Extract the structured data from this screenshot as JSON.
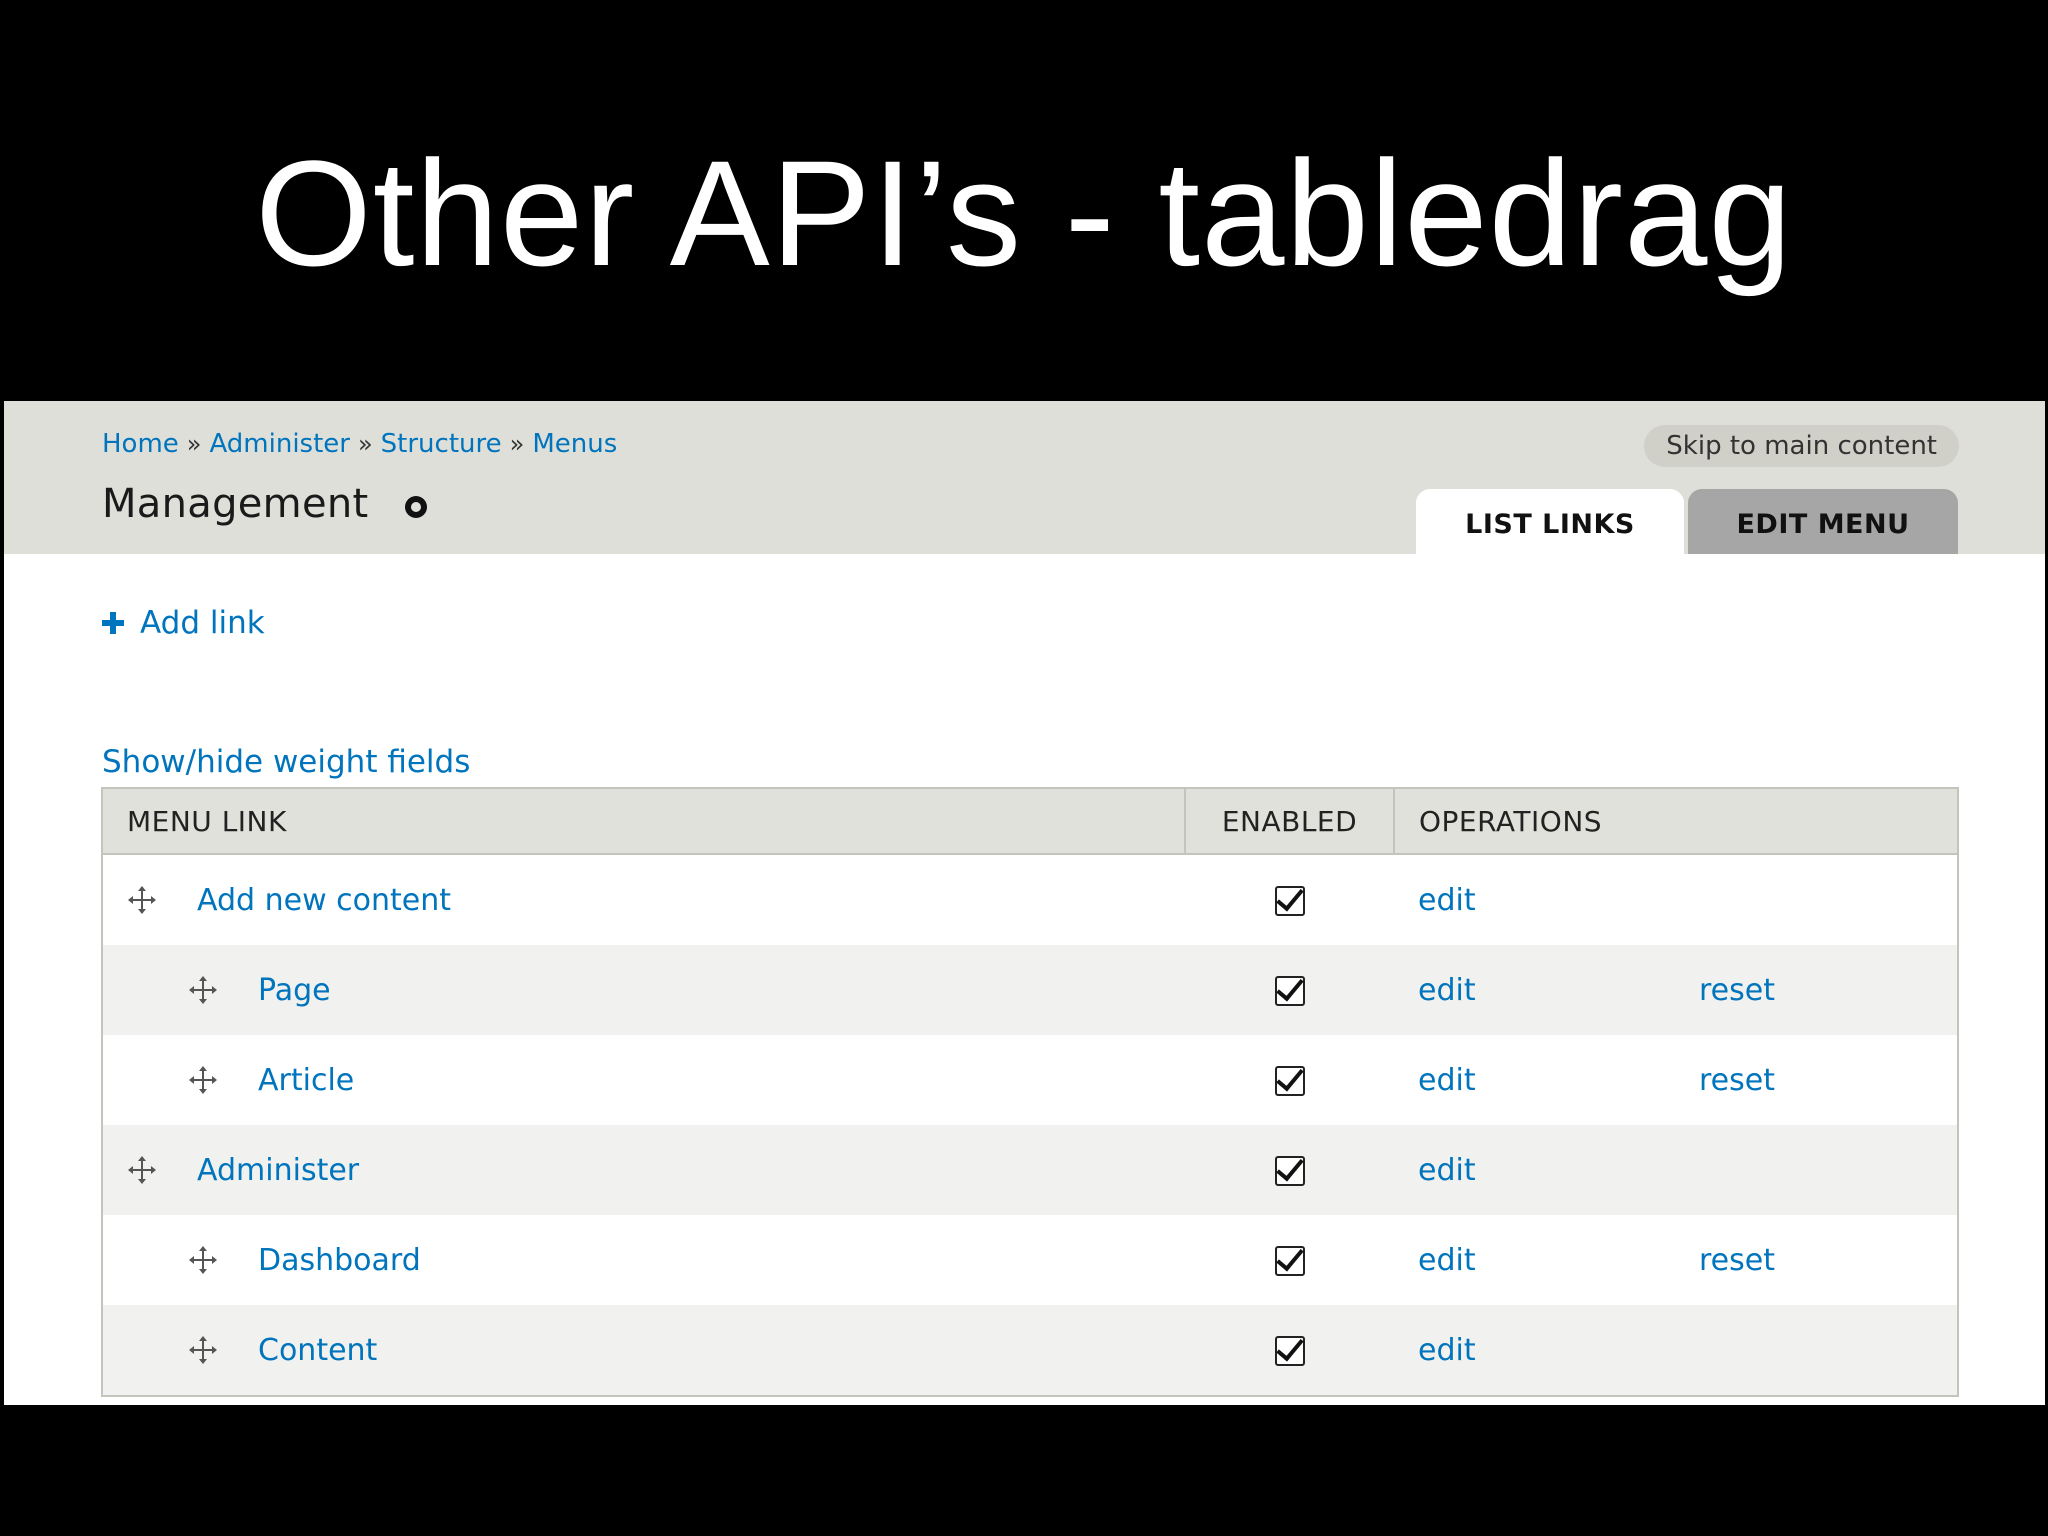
{
  "slide": {
    "title": "Other API’s - tabledrag"
  },
  "header": {
    "breadcrumb": [
      "Home",
      "Administer",
      "Structure",
      "Menus"
    ],
    "breadcrumb_separator": "»",
    "page_title": "Management",
    "skip_link": "Skip to main content",
    "tabs": [
      {
        "label": "LIST LINKS",
        "active": true
      },
      {
        "label": "EDIT MENU",
        "active": false
      }
    ]
  },
  "actions": {
    "add_link": "Add link",
    "weight_toggle": "Show/hide weight fields"
  },
  "table": {
    "headers": {
      "menu_link": "MENU LINK",
      "enabled": "ENABLED",
      "operations": "OPERATIONS"
    },
    "rows": [
      {
        "title": "Add new content",
        "depth": 0,
        "enabled": true,
        "edit": "edit",
        "reset": ""
      },
      {
        "title": "Page",
        "depth": 1,
        "enabled": true,
        "edit": "edit",
        "reset": "reset"
      },
      {
        "title": "Article",
        "depth": 1,
        "enabled": true,
        "edit": "edit",
        "reset": "reset"
      },
      {
        "title": "Administer",
        "depth": 0,
        "enabled": true,
        "edit": "edit",
        "reset": ""
      },
      {
        "title": "Dashboard",
        "depth": 1,
        "enabled": true,
        "edit": "edit",
        "reset": "reset"
      },
      {
        "title": "Content",
        "depth": 1,
        "enabled": true,
        "edit": "edit",
        "reset": ""
      }
    ]
  },
  "colors": {
    "link": "#0074bd",
    "header_bg": "#dfdfd9",
    "slide_bg": "#000000"
  }
}
